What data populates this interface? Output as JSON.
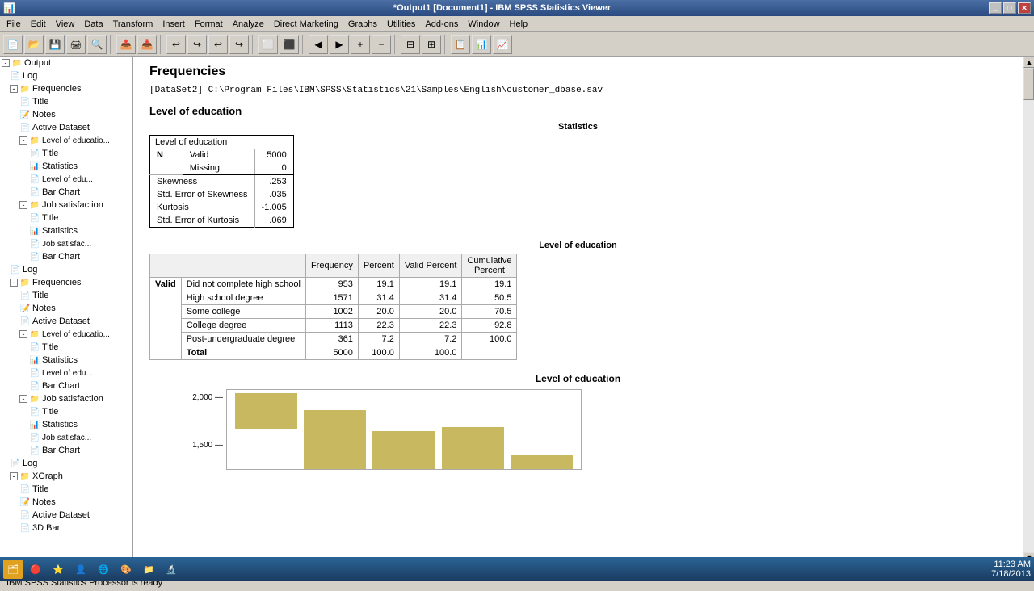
{
  "titlebar": {
    "title": "*Output1 [Document1] - IBM SPSS Statistics Viewer",
    "icon": "📊"
  },
  "menubar": {
    "items": [
      "File",
      "Edit",
      "View",
      "Data",
      "Transform",
      "Insert",
      "Format",
      "Analyze",
      "Direct Marketing",
      "Graphs",
      "Utilities",
      "Add-ons",
      "Window",
      "Help"
    ]
  },
  "outline": {
    "items": [
      {
        "label": "Output",
        "level": 0,
        "type": "folder",
        "expanded": true
      },
      {
        "label": "Log",
        "level": 1,
        "type": "doc"
      },
      {
        "label": "Frequencies",
        "level": 1,
        "type": "folder",
        "expanded": true
      },
      {
        "label": "Title",
        "level": 2,
        "type": "doc"
      },
      {
        "label": "Notes",
        "level": 2,
        "type": "note"
      },
      {
        "label": "Active Dataset",
        "level": 2,
        "type": "doc"
      },
      {
        "label": "Level of educatio...",
        "level": 2,
        "type": "folder",
        "expanded": true
      },
      {
        "label": "Title",
        "level": 3,
        "type": "doc"
      },
      {
        "label": "Statistics",
        "level": 3,
        "type": "red"
      },
      {
        "label": "Level of edu...",
        "level": 3,
        "type": "doc"
      },
      {
        "label": "Bar Chart",
        "level": 3,
        "type": "doc"
      },
      {
        "label": "Job satisfaction",
        "level": 2,
        "type": "folder",
        "expanded": true
      },
      {
        "label": "Title",
        "level": 3,
        "type": "doc"
      },
      {
        "label": "Statistics",
        "level": 3,
        "type": "red"
      },
      {
        "label": "Job satisfac...",
        "level": 3,
        "type": "doc"
      },
      {
        "label": "Bar Chart",
        "level": 3,
        "type": "doc"
      },
      {
        "label": "Log",
        "level": 1,
        "type": "doc"
      },
      {
        "label": "Frequencies",
        "level": 1,
        "type": "folder",
        "expanded": true
      },
      {
        "label": "Title",
        "level": 2,
        "type": "doc"
      },
      {
        "label": "Notes",
        "level": 2,
        "type": "note"
      },
      {
        "label": "Active Dataset",
        "level": 2,
        "type": "doc"
      },
      {
        "label": "Level of educatio...",
        "level": 2,
        "type": "folder",
        "expanded": true
      },
      {
        "label": "Title",
        "level": 3,
        "type": "doc"
      },
      {
        "label": "Statistics",
        "level": 3,
        "type": "red"
      },
      {
        "label": "Level of edu...",
        "level": 3,
        "type": "doc"
      },
      {
        "label": "Bar Chart",
        "level": 3,
        "type": "doc"
      },
      {
        "label": "Job satisfaction",
        "level": 2,
        "type": "folder",
        "expanded": true
      },
      {
        "label": "Title",
        "level": 3,
        "type": "doc"
      },
      {
        "label": "Statistics",
        "level": 3,
        "type": "red"
      },
      {
        "label": "Job satisfac...",
        "level": 3,
        "type": "doc"
      },
      {
        "label": "Bar Chart",
        "level": 3,
        "type": "doc"
      },
      {
        "label": "Log",
        "level": 1,
        "type": "doc"
      },
      {
        "label": "XGraph",
        "level": 1,
        "type": "folder",
        "expanded": true
      },
      {
        "label": "Title",
        "level": 2,
        "type": "doc"
      },
      {
        "label": "Notes",
        "level": 2,
        "type": "note"
      },
      {
        "label": "Active Dataset",
        "level": 2,
        "type": "doc"
      },
      {
        "label": "3D Bar",
        "level": 2,
        "type": "doc"
      }
    ]
  },
  "content": {
    "main_title": "Frequencies",
    "dataset_path": "[DataSet2] C:\\Program Files\\IBM\\SPSS\\Statistics\\21\\Samples\\English\\customer_dbase.sav",
    "section1_title": "Level of education",
    "statistics_label": "Statistics",
    "stats_sublabel": "Level of education",
    "stats_table": {
      "headers": [
        "N",
        "Valid",
        "Missing"
      ],
      "values": {
        "valid": "5000",
        "missing": "0",
        "skewness": ".253",
        "std_err_skewness": ".035",
        "kurtosis": "-1.005",
        "std_err_kurtosis": ".069"
      },
      "row_labels": [
        "Skewness",
        "Std. Error of Skewness",
        "Kurtosis",
        "Std. Error of Kurtosis"
      ]
    },
    "freq_table_title": "Level of education",
    "freq_headers": [
      "",
      "Frequency",
      "Percent",
      "Valid Percent",
      "Cumulative Percent"
    ],
    "freq_rows": [
      {
        "valid": "Valid",
        "label": "Did not complete high school",
        "frequency": "953",
        "percent": "19.1",
        "valid_pct": "19.1",
        "cum_pct": "19.1"
      },
      {
        "valid": "",
        "label": "High school degree",
        "frequency": "1571",
        "percent": "31.4",
        "valid_pct": "31.4",
        "cum_pct": "50.5"
      },
      {
        "valid": "",
        "label": "Some college",
        "frequency": "1002",
        "percent": "20.0",
        "valid_pct": "20.0",
        "cum_pct": "70.5"
      },
      {
        "valid": "",
        "label": "College degree",
        "frequency": "1113",
        "percent": "22.3",
        "valid_pct": "22.3",
        "cum_pct": "92.8"
      },
      {
        "valid": "",
        "label": "Post-undergraduate degree",
        "frequency": "361",
        "percent": "7.2",
        "valid_pct": "7.2",
        "cum_pct": "100.0"
      },
      {
        "valid": "",
        "label": "Total",
        "frequency": "5000",
        "percent": "100.0",
        "valid_pct": "100.0",
        "cum_pct": ""
      }
    ],
    "chart_title": "Level of education",
    "chart_y_labels": [
      "2,000-",
      "1,500-"
    ],
    "bar_colors": [
      "#c8b860",
      "#888888",
      "#dddddd",
      "#aaaaaa",
      "#666666"
    ]
  },
  "statusbar": {
    "text": "IBM SPSS Statistics Processor is ready"
  },
  "taskbar": {
    "time": "11:23 AM",
    "date": "7/18/2013",
    "items": [
      "🖥",
      "🔴",
      "⭐",
      "👤",
      "🌐",
      "🎨",
      "📁",
      "🔬"
    ]
  }
}
